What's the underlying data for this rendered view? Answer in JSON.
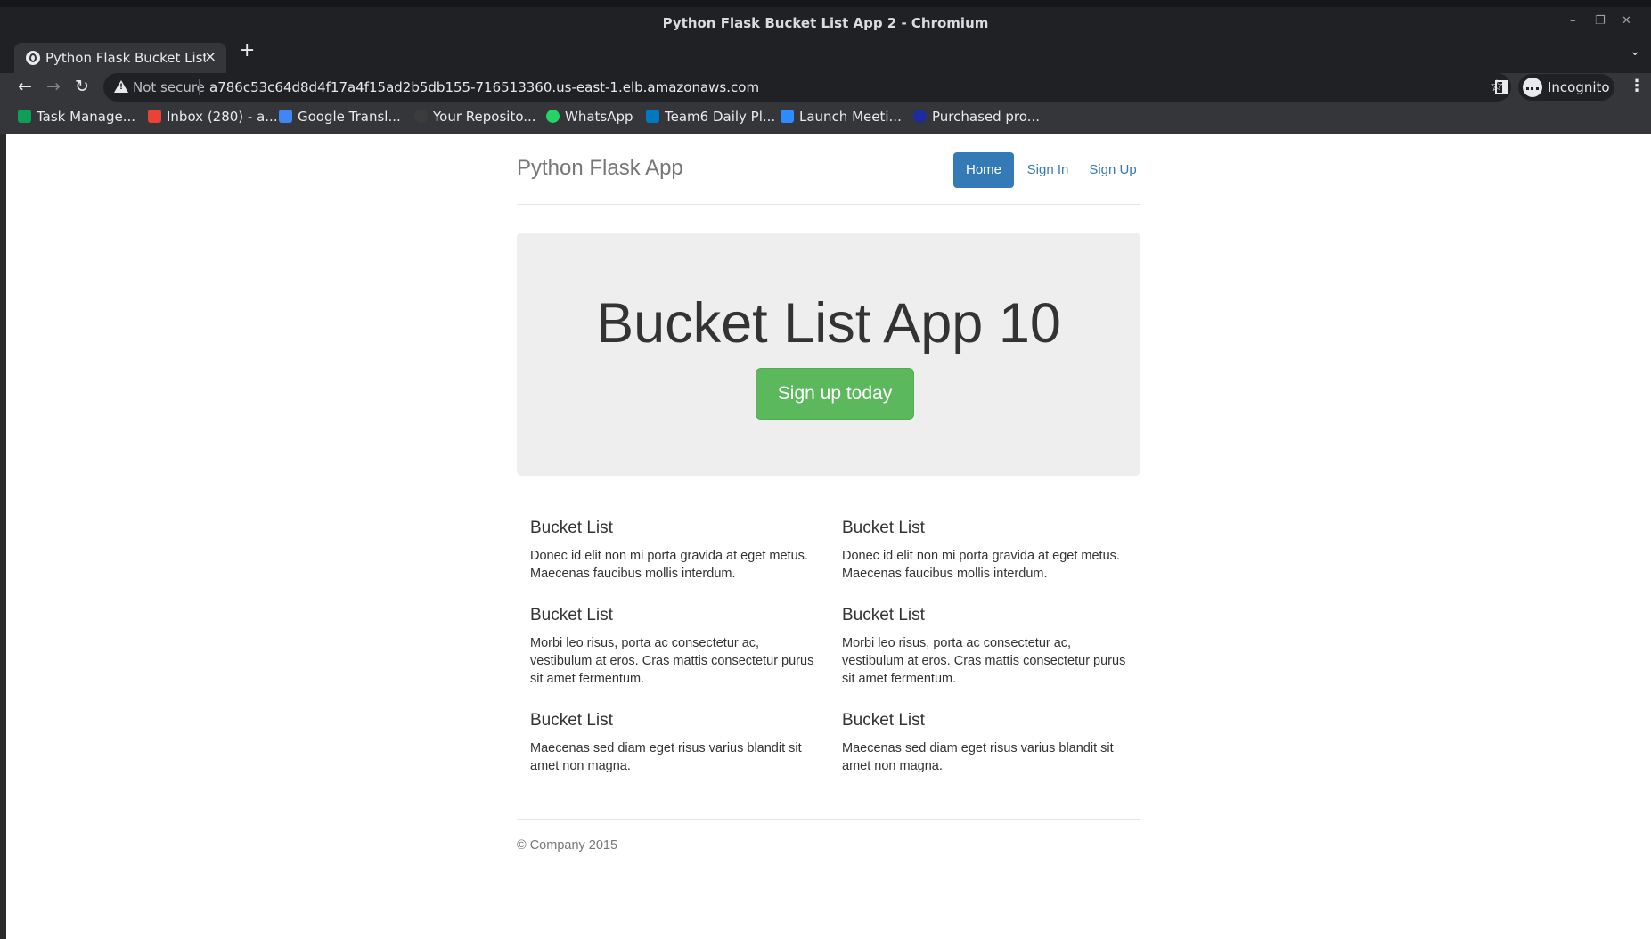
{
  "browser": {
    "window_title": "Python Flask Bucket List App 2 - Chromium",
    "tab_title": "Python Flask Bucket List App",
    "tab_close": "×",
    "new_tab": "+",
    "url_security": "Not secure",
    "url": "a786c53c64d8d4f17a4f15ad2b5db155-716513360.us-east-1.elb.amazonaws.com",
    "profile_label": "Incognito",
    "bookmarks": [
      {
        "label": "Task Manage...",
        "icon": "task-manager-icon",
        "color": "#0f9d58"
      },
      {
        "label": "Inbox (280) - a...",
        "icon": "gmail-icon",
        "color": "#ea4335"
      },
      {
        "label": "Google Transl...",
        "icon": "google-translate-icon",
        "color": "#4285f4"
      },
      {
        "label": "Your Reposito...",
        "icon": "github-icon",
        "color": "#3c3c3c"
      },
      {
        "label": "WhatsApp",
        "icon": "whatsapp-icon",
        "color": "#25d366"
      },
      {
        "label": "Team6 Daily Pl...",
        "icon": "trello-icon",
        "color": "#0079bf"
      },
      {
        "label": "Launch Meeti...",
        "icon": "zoom-icon",
        "color": "#2d8cff"
      },
      {
        "label": "Purchased pro...",
        "icon": "meta-icon",
        "color": "#1c2b9e"
      }
    ]
  },
  "page": {
    "brand": "Python Flask App",
    "nav": [
      {
        "label": "Home",
        "active": true
      },
      {
        "label": "Sign In",
        "active": false
      },
      {
        "label": "Sign Up",
        "active": false
      }
    ],
    "jumbotron": {
      "heading": "Bucket List App 10",
      "button": "Sign up today"
    },
    "items": [
      {
        "title": "Bucket List",
        "text": "Donec id elit non mi porta gravida at eget metus. Maecenas faucibus mollis interdum."
      },
      {
        "title": "Bucket List",
        "text": "Donec id elit non mi porta gravida at eget metus. Maecenas faucibus mollis interdum."
      },
      {
        "title": "Bucket List",
        "text": "Morbi leo risus, porta ac consectetur ac, vestibulum at eros. Cras mattis consectetur purus sit amet fermentum."
      },
      {
        "title": "Bucket List",
        "text": "Morbi leo risus, porta ac consectetur ac, vestibulum at eros. Cras mattis consectetur purus sit amet fermentum."
      },
      {
        "title": "Bucket List",
        "text": "Maecenas sed diam eget risus varius blandit sit amet non magna."
      },
      {
        "title": "Bucket List",
        "text": "Maecenas sed diam eget risus varius blandit sit amet non magna."
      }
    ],
    "footer": "© Company 2015"
  },
  "colors": {
    "primary": "#337ab7",
    "success": "#5cb85c",
    "jumbotron_bg": "#eeeeee",
    "chrome_dark": "#202124",
    "chrome_toolbar": "#35363a"
  }
}
